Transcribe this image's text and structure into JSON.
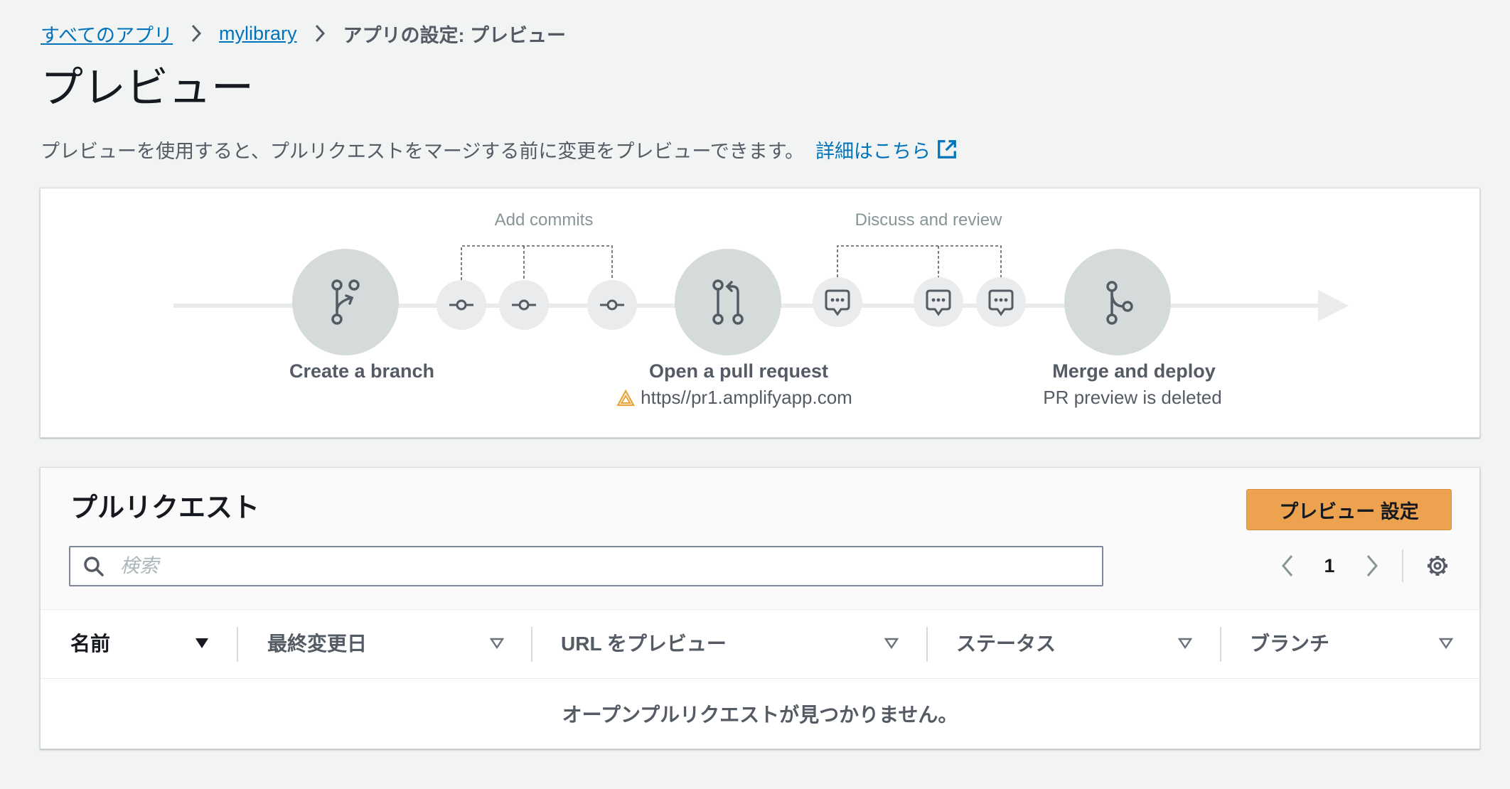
{
  "breadcrumb": {
    "items": [
      {
        "label": "すべてのアプリ"
      },
      {
        "label": "mylibrary"
      },
      {
        "label": "アプリの設定: プレビュー"
      }
    ]
  },
  "page": {
    "title": "プレビュー",
    "description": "プレビューを使用すると、プルリクエストをマージする前に変更をプレビューできます。",
    "learn_more": "詳細はこちら"
  },
  "diagram": {
    "add_commits": "Add commits",
    "discuss_review": "Discuss and review",
    "steps": [
      {
        "label": "Create a branch"
      },
      {
        "label": "Open a pull request",
        "sublabel": "https//pr1.amplifyapp.com"
      },
      {
        "label": "Merge and deploy",
        "sublabel": "PR preview is deleted"
      }
    ]
  },
  "pull_requests": {
    "heading": "プルリクエスト",
    "settings_button": "プレビュー 設定",
    "search": {
      "placeholder": "検索",
      "value": ""
    },
    "pagination": {
      "current_page": "1"
    },
    "columns": [
      {
        "label": "名前",
        "sort": "descending"
      },
      {
        "label": "最終変更日",
        "sort": "none"
      },
      {
        "label": "URL をプレビュー",
        "sort": "none"
      },
      {
        "label": "ステータス",
        "sort": "none"
      },
      {
        "label": "ブランチ",
        "sort": "none"
      }
    ],
    "rows": [],
    "empty_message": "オープンプルリクエストが見つかりません。"
  },
  "icons": {
    "breadcrumb_separator": "chevron-right-icon",
    "learn_more": "external-link-icon",
    "create_branch": "git-branch-icon",
    "commit": "commit-icon",
    "open_pr": "pull-request-icon",
    "comment": "comment-icon",
    "merge": "merge-icon",
    "preview_url_status": "warning-icon",
    "search": "search-icon",
    "prev_page": "chevron-left-icon",
    "next_page": "chevron-right-icon",
    "preferences": "gear-icon",
    "sorted_column": "sort-descending-filled-icon",
    "sortable_column": "sort-outline-icon"
  },
  "colors": {
    "page_background": "#f2f3f3",
    "link": "#0073bb",
    "primary_button": "#eca24f",
    "text_primary": "#16191f",
    "text_secondary": "#545b64",
    "diagram_node": "#d5dbdb",
    "diagram_line": "#e9ebed",
    "warning": "#e8a33a"
  }
}
